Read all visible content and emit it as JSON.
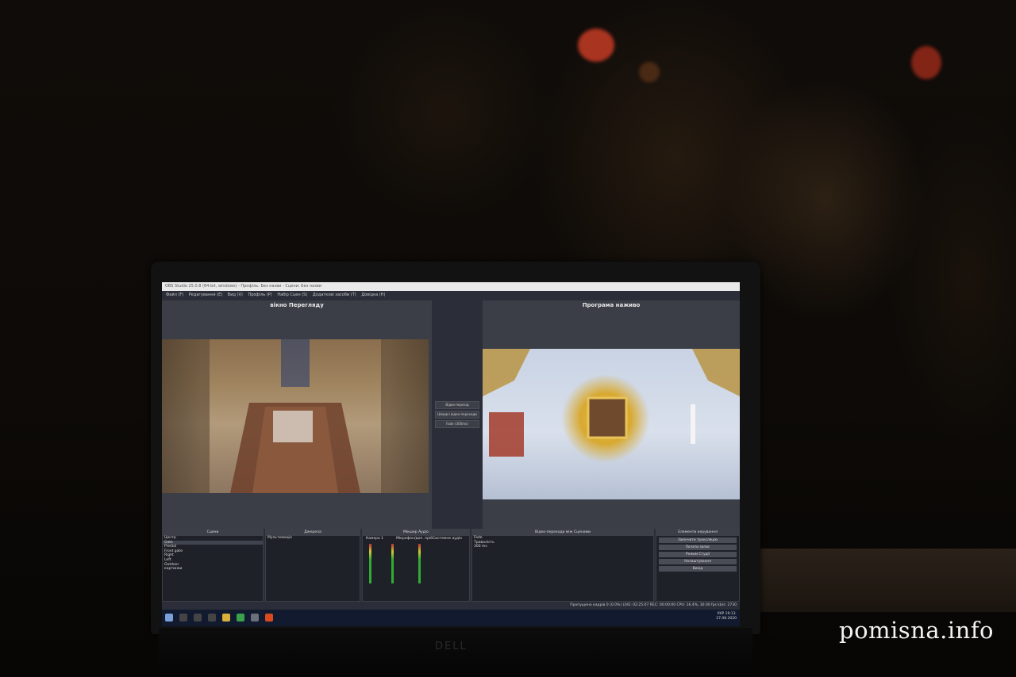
{
  "screen": {
    "window_title": "OBS Studio 25.0.8 (64-bit, windows) - Профіль: Без назви - Сцени: Без назви",
    "menu": [
      "Файл (F)",
      "Редагування (E)",
      "Вид (V)",
      "Профіль (P)",
      "Набір Сцен (S)",
      "Додаткові засоби (T)",
      "Довідка (H)"
    ],
    "preview_label": "вікно Перегляду",
    "program_label": "Програма наживо",
    "transition": {
      "button": "Відео-перехід",
      "quick": "Швидкі відео-переходи",
      "selected": "Fade (300ms)"
    },
    "docks": {
      "scenes_title": "Сцени",
      "scenes": [
        "Центр",
        "Gate",
        "Prestol",
        "Front gate",
        "Right",
        "Left",
        "Outdoor",
        "картинки"
      ],
      "sources_title": "Джерела",
      "sources": [
        "Мультимедіа"
      ],
      "mixer_title": "Мікшер Аудіо",
      "mixer_channels": [
        {
          "name": "Камера 1",
          "level": "0.0 dB"
        },
        {
          "name": "Мікрофон/доп. пріб",
          "level": "0.0 dB"
        },
        {
          "name": "Системне аудіо",
          "level": "0.0 dB"
        }
      ],
      "transitions_title": "Відео-переходи між Сценами",
      "transition_type": "Fade",
      "duration_label": "Тривалість",
      "duration_value": "300 ms",
      "controls_title": "Елементи керування",
      "controls": [
        "Закінчити трансляцію",
        "Почати запис",
        "Режим Студії",
        "Налаштування",
        "Вихід"
      ]
    },
    "status": "Пропущено кадрів 0 (0.0%)   LIVE: 02:25:07   REC: 00:00:00   CPU: 16.4%, 30.00 fps   kb/s: 2730",
    "taskbar": {
      "time": "19:13",
      "date": "27.08.2020",
      "lang": "УКР"
    }
  },
  "laptop_brand": "DELL",
  "watermark": "pomisna.info"
}
